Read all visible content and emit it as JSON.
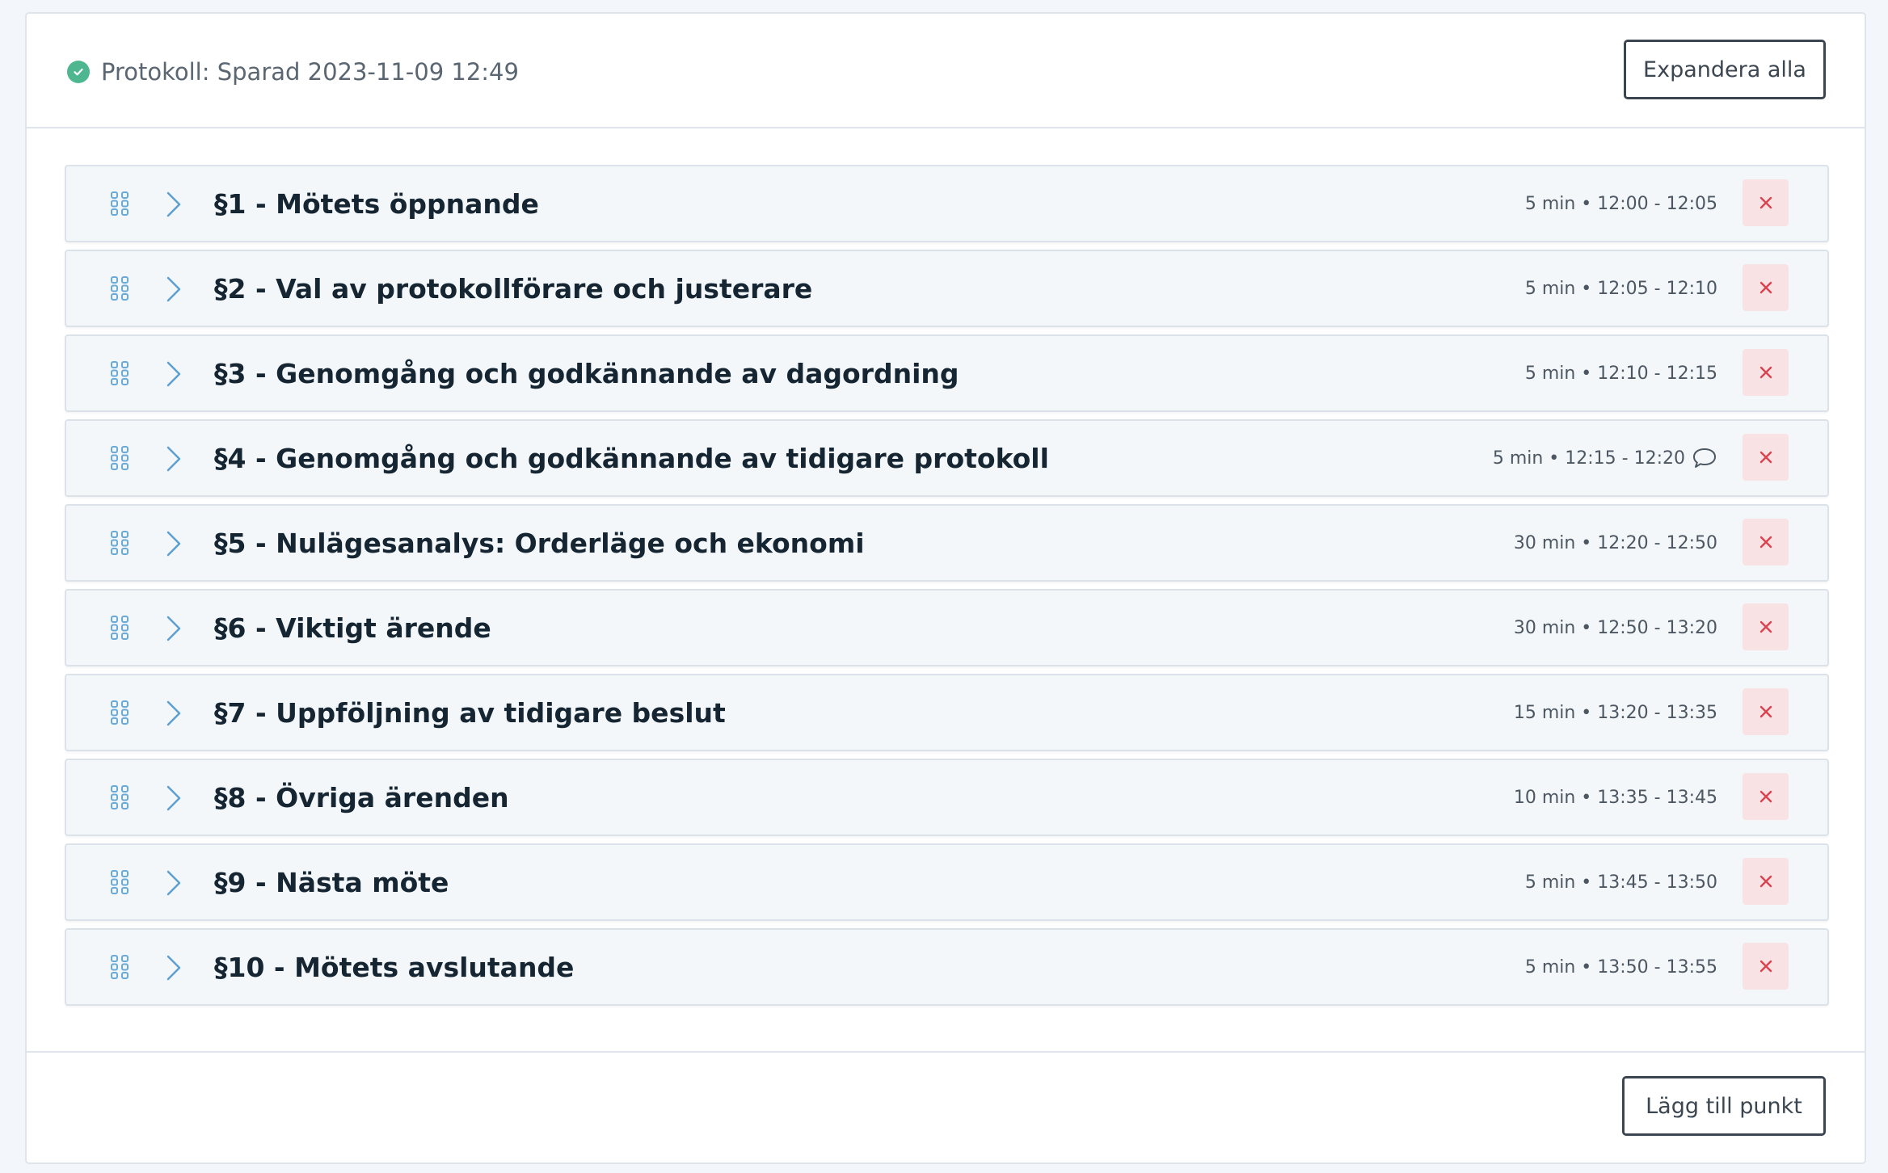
{
  "header": {
    "status_text": "Protokoll: Sparad 2023-11-09 12:49",
    "status_icon": "check-circle-icon",
    "expand_label": "Expandera alla"
  },
  "items": [
    {
      "title": "§1 - Mötets öppnande",
      "meta": "5 min • 12:00 - 12:05",
      "has_comment": false
    },
    {
      "title": "§2 - Val av protokollförare och justerare",
      "meta": "5 min • 12:05 - 12:10",
      "has_comment": false
    },
    {
      "title": "§3 - Genomgång och godkännande av dagordning",
      "meta": "5 min • 12:10 - 12:15",
      "has_comment": false
    },
    {
      "title": "§4 - Genomgång och godkännande av tidigare protokoll",
      "meta": "5 min • 12:15 - 12:20",
      "has_comment": true
    },
    {
      "title": "§5 - Nulägesanalys: Orderläge och ekonomi",
      "meta": "30 min • 12:20 - 12:50",
      "has_comment": false
    },
    {
      "title": "§6 - Viktigt ärende",
      "meta": "30 min • 12:50 - 13:20",
      "has_comment": false
    },
    {
      "title": "§7 - Uppföljning av tidigare beslut",
      "meta": "15 min • 13:20 - 13:35",
      "has_comment": false
    },
    {
      "title": "§8 - Övriga ärenden",
      "meta": "10 min • 13:35 - 13:45",
      "has_comment": false
    },
    {
      "title": "§9 - Nästa möte",
      "meta": "5 min • 13:45 - 13:50",
      "has_comment": false
    },
    {
      "title": "§10 - Mötets avslutande",
      "meta": "5 min • 13:50 - 13:55",
      "has_comment": false
    }
  ],
  "footer": {
    "add_label": "Lägg till punkt"
  },
  "colors": {
    "success": "#4fb78f",
    "drag_handle": "#6aaad6",
    "remove": "#d9434f",
    "remove_bg": "#f9e2e4"
  }
}
